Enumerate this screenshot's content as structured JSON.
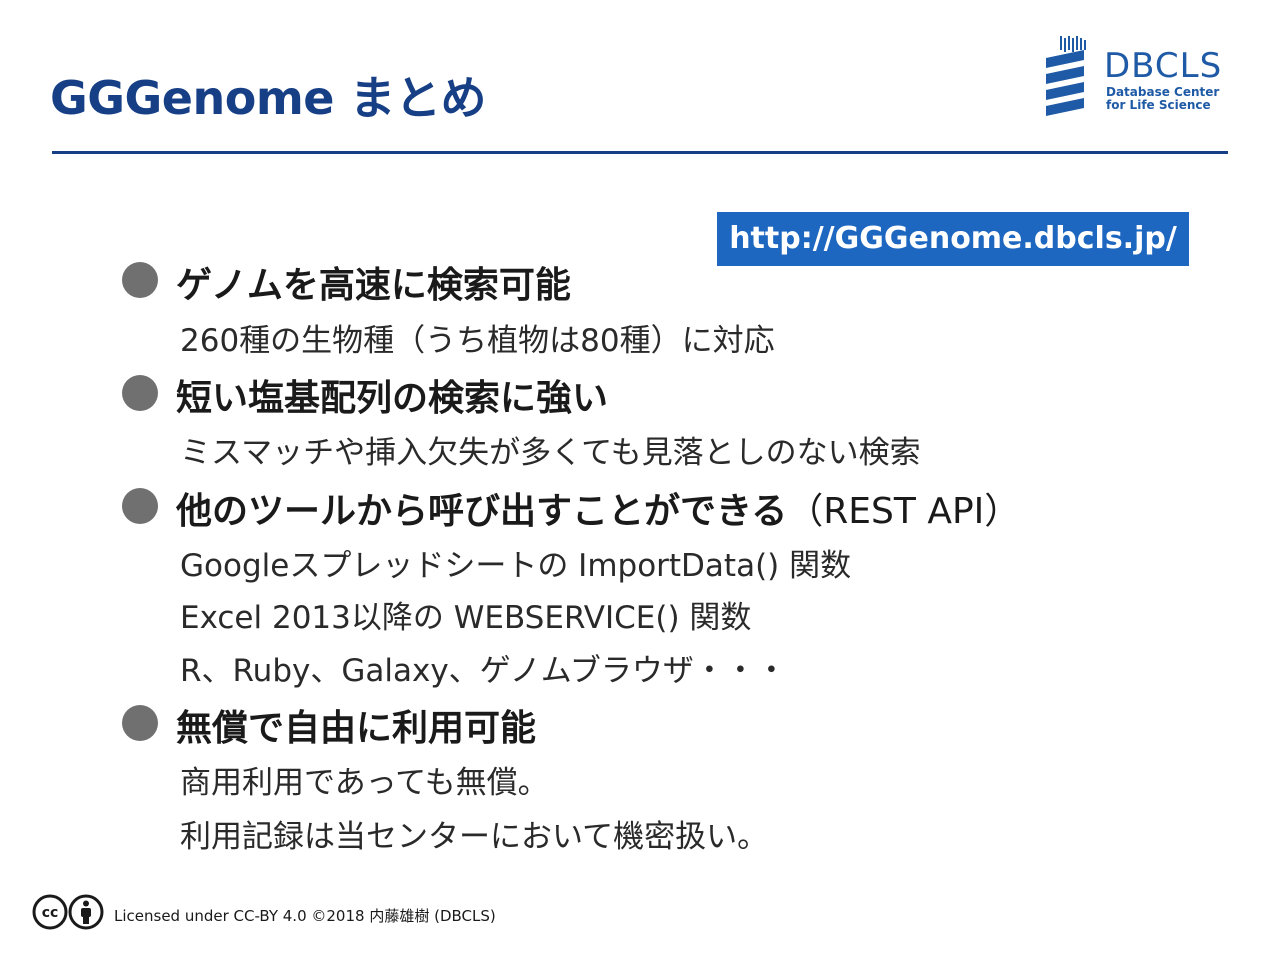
{
  "slide": {
    "title": "GGGenome まとめ",
    "url": "http://GGGenome.dbcls.jp/"
  },
  "logo": {
    "name": "DBCLS",
    "line1": "Database Center",
    "line2": "for Life Science",
    "icon": "dna-helix-icon"
  },
  "bullets": [
    {
      "text": "ゲノムを高速に検索可能",
      "suffix": "",
      "sub": [
        "260種の生物種（うち植物は80種）に対応"
      ]
    },
    {
      "text": "短い塩基配列の検索に強い",
      "suffix": "",
      "sub": [
        "ミスマッチや挿入欠失が多くても見落としのない検索"
      ]
    },
    {
      "text": "他のツールから呼び出すことができる",
      "suffix": "（REST API）",
      "sub": [
        "Googleスプレッドシートの ImportData() 関数",
        "Excel 2013以降の WEBSERVICE() 関数",
        "R、Ruby、Galaxy、ゲノムブラウザ・・・"
      ]
    },
    {
      "text": "無償で自由に利用可能",
      "suffix": "",
      "sub": [
        "商用利用であっても無償。",
        "利用記録は当センターにおいて機密扱い。"
      ]
    }
  ],
  "footer": {
    "license_text": "Licensed under CC-BY 4.0 ©2018 内藤雄樹 (DBCLS)",
    "cc_label": "cc",
    "icons": [
      "cc-icon",
      "by-person-icon"
    ]
  },
  "colors": {
    "title": "#173f86",
    "url_box": "#1d67c0",
    "bullet": "#707070"
  }
}
